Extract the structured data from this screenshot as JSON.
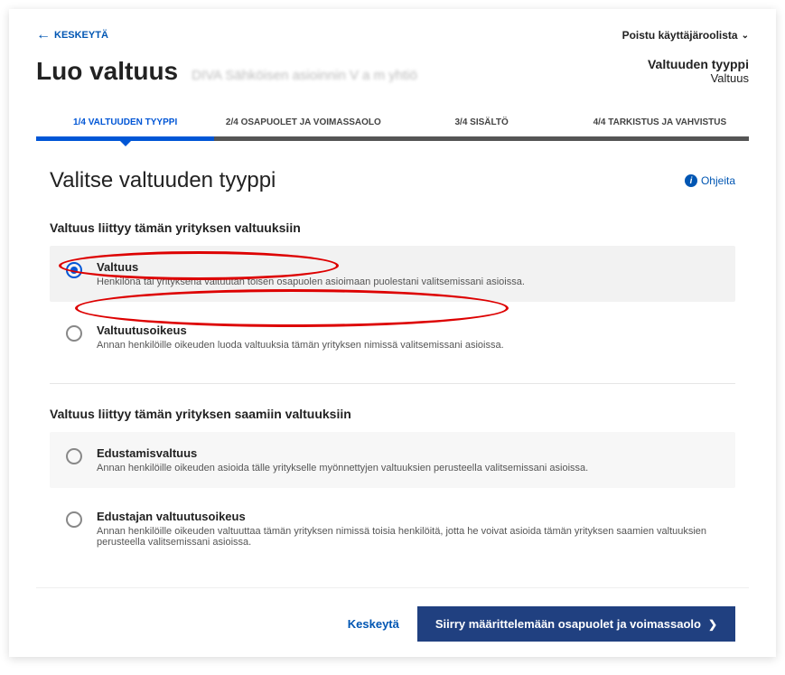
{
  "topbar": {
    "cancel": "KESKEYTÄ",
    "role_exit": "Poistu käyttäjäroolista"
  },
  "header": {
    "title": "Luo valtuus",
    "subtitle": "DIVA Sähköisen asioinnin V a m   yhtiö",
    "right_title": "Valtuuden tyyppi",
    "right_sub": "Valtuus"
  },
  "stepper": {
    "steps": [
      "1/4 VALTUUDEN TYYPPI",
      "2/4 OSAPUOLET JA VOIMASSAOLO",
      "3/4 SISÄLTÖ",
      "4/4 TARKISTUS JA VAHVISTUS"
    ]
  },
  "section": {
    "title": "Valitse valtuuden tyyppi",
    "help": "Ohjeita"
  },
  "groups": [
    {
      "heading": "Valtuus liittyy tämän yrityksen valtuuksiin",
      "options": [
        {
          "label": "Valtuus",
          "desc": "Henkilönä tai yrityksenä valtuutan toisen osapuolen asioimaan puolestani valitsemissani asioissa.",
          "selected": true
        },
        {
          "label": "Valtuutusoikeus",
          "desc": "Annan henkilöille oikeuden luoda valtuuksia tämän yrityksen nimissä valitsemissani asioissa.",
          "selected": false
        }
      ]
    },
    {
      "heading": "Valtuus liittyy tämän yrityksen saamiin valtuuksiin",
      "options": [
        {
          "label": "Edustamisvaltuus",
          "desc": "Annan henkilöille oikeuden asioida tälle yritykselle myönnettyjen valtuuksien perusteella valitsemissani asioissa.",
          "selected": false
        },
        {
          "label": "Edustajan valtuutusoikeus",
          "desc": "Annan henkilöille oikeuden valtuuttaa tämän yrityksen nimissä toisia henkilöitä, jotta he voivat asioida tämän yrityksen saamien valtuuksien perusteella valitsemissani asioissa.",
          "selected": false
        }
      ]
    }
  ],
  "footer": {
    "cancel": "Keskeytä",
    "next": "Siirry määrittelemään osapuolet ja voimassaolo"
  }
}
